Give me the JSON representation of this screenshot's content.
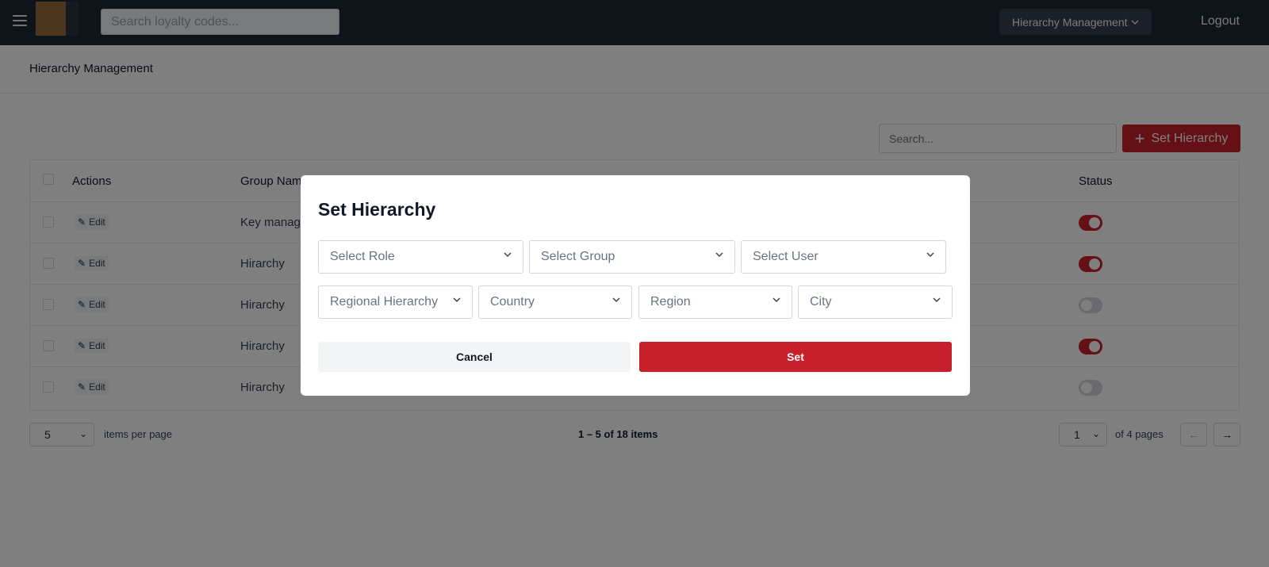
{
  "navbar": {
    "search_placeholder": "Search loyalty codes...",
    "module_dropdown": "Hierarchy Management",
    "logout": "Logout"
  },
  "page": {
    "title": "Hierarchy Management"
  },
  "toolbar": {
    "search_placeholder": "Search...",
    "set_hierarchy_label": "Set Hierarchy"
  },
  "table": {
    "headers": {
      "actions": "Actions",
      "group_name": "Group Nam",
      "status": "Status"
    },
    "rows": [
      {
        "edit": "Edit",
        "group": "Key manag",
        "status": "on"
      },
      {
        "edit": "Edit",
        "group": "Hirarchy",
        "status": "on"
      },
      {
        "edit": "Edit",
        "group": "Hirarchy",
        "status": "off"
      },
      {
        "edit": "Edit",
        "group": "Hirarchy",
        "status": "on"
      },
      {
        "edit": "Edit",
        "group": "Hirarchy",
        "status": "off"
      }
    ]
  },
  "pagination": {
    "per_page_value": "5",
    "per_page_label": "items per page",
    "summary": "1 – 5 of 18 items",
    "page_value": "1",
    "of_pages": "of 4 pages"
  },
  "modal": {
    "title": "Set Hierarchy",
    "selects_row1": [
      "Select Role",
      "Select Group",
      "Select User"
    ],
    "selects_row2": [
      "Regional Hierarchy",
      "Country",
      "Region",
      "City"
    ],
    "cancel": "Cancel",
    "set": "Set"
  },
  "colors": {
    "accent": "#c8202a",
    "navbar": "#1f2937"
  }
}
